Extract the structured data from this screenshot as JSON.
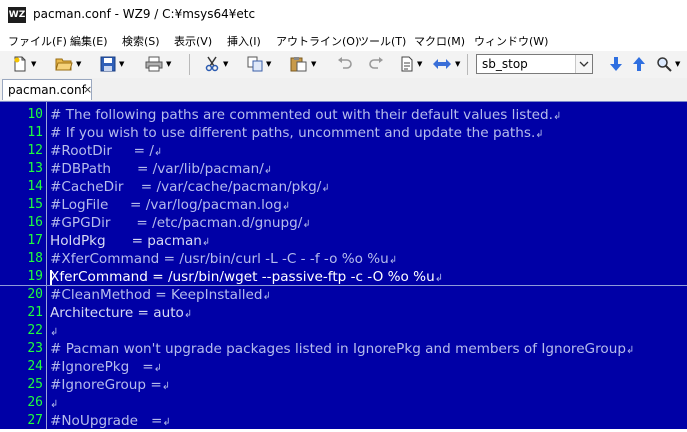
{
  "window": {
    "icon_text": "WZ",
    "title": "pacman.conf - WZ9 / C:¥msys64¥etc"
  },
  "menu": [
    "ファイル(F)",
    "編集(E)",
    "検索(S)",
    "表示(V)",
    "挿入(I)",
    "アウトライン(O)",
    "ツール(T)",
    "マクロ(M)",
    "ウィンドウ(W)"
  ],
  "toolbar": {
    "search_value": "sb_stop",
    "icons": [
      "new-document-icon",
      "open-folder-icon",
      "save-icon",
      "print-icon",
      "cut-icon",
      "copy-icon",
      "paste-icon",
      "undo-icon",
      "redo-icon",
      "document-options-icon",
      "jump-icon",
      "search-down-icon",
      "search-up-icon",
      "magnifier-icon"
    ]
  },
  "tab": {
    "label": "pacman.conf",
    "close": "×"
  },
  "colors": {
    "editor_bg": "#0000a6",
    "line_number": "#1fff3c",
    "text": "#d8dbf4"
  },
  "editor": {
    "eol_mark": "↲",
    "cursor_line": 19,
    "lines": [
      {
        "n": "10",
        "text": "# The following paths are commented out with their default values listed.",
        "type": "comment"
      },
      {
        "n": "11",
        "text": "# If you wish to use different paths, uncomment and update the paths.",
        "type": "comment"
      },
      {
        "n": "12",
        "text": "#RootDir     = /",
        "type": "comment"
      },
      {
        "n": "13",
        "text": "#DBPath      = /var/lib/pacman/",
        "type": "comment"
      },
      {
        "n": "14",
        "text": "#CacheDir    = /var/cache/pacman/pkg/",
        "type": "comment"
      },
      {
        "n": "15",
        "text": "#LogFile     = /var/log/pacman.log",
        "type": "comment"
      },
      {
        "n": "16",
        "text": "#GPGDir      = /etc/pacman.d/gnupg/",
        "type": "comment"
      },
      {
        "n": "17",
        "text": "HoldPkg      = pacman",
        "type": "code"
      },
      {
        "n": "18",
        "text": "#XferCommand = /usr/bin/curl -L -C - -f -o %o %u",
        "type": "comment"
      },
      {
        "n": "19",
        "text": "XferCommand = /usr/bin/wget --passive-ftp -c -O %o %u",
        "type": "active"
      },
      {
        "n": "20",
        "text": "#CleanMethod = KeepInstalled",
        "type": "comment"
      },
      {
        "n": "21",
        "text": "Architecture = auto",
        "type": "code"
      },
      {
        "n": "22",
        "text": "",
        "type": "code"
      },
      {
        "n": "23",
        "text": "# Pacman won't upgrade packages listed in IgnorePkg and members of IgnoreGroup",
        "type": "comment"
      },
      {
        "n": "24",
        "text": "#IgnorePkg   =",
        "type": "comment"
      },
      {
        "n": "25",
        "text": "#IgnoreGroup =",
        "type": "comment"
      },
      {
        "n": "26",
        "text": "",
        "type": "code"
      },
      {
        "n": "27",
        "text": "#NoUpgrade   =",
        "type": "comment"
      }
    ]
  }
}
